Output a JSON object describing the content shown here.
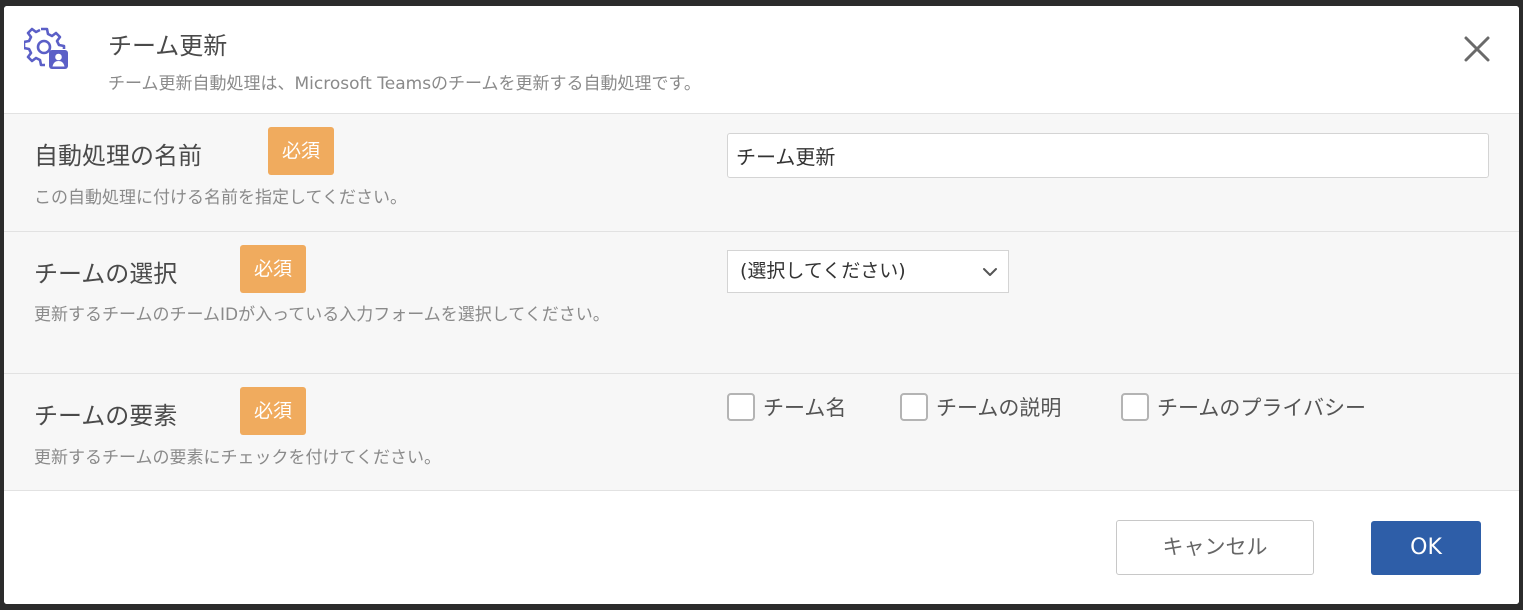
{
  "header": {
    "icon": "team-settings-icon",
    "icon_color": "#5b5fc7",
    "title": "チーム更新",
    "description": "チーム更新自動処理は、Microsoft Teamsのチームを更新する自動処理です。"
  },
  "fields": {
    "name": {
      "label": "自動処理の名前",
      "badge": "必須",
      "help": "この自動処理に付ける名前を指定してください。",
      "value": "チーム更新"
    },
    "team": {
      "label": "チームの選択",
      "badge": "必須",
      "help": "更新するチームのチームIDが入っている入力フォームを選択してください。",
      "selected": "(選択してください)"
    },
    "elements": {
      "label": "チームの要素",
      "badge": "必須",
      "help": "更新するチームの要素にチェックを付けてください。",
      "options": [
        {
          "label": "チーム名",
          "checked": false
        },
        {
          "label": "チームの説明",
          "checked": false
        },
        {
          "label": "チームのプライバシー",
          "checked": false
        }
      ]
    }
  },
  "footer": {
    "cancel_label": "キャンセル",
    "ok_label": "OK"
  },
  "colors": {
    "badge": "#f0ab5e",
    "primary": "#2e5ea8"
  }
}
